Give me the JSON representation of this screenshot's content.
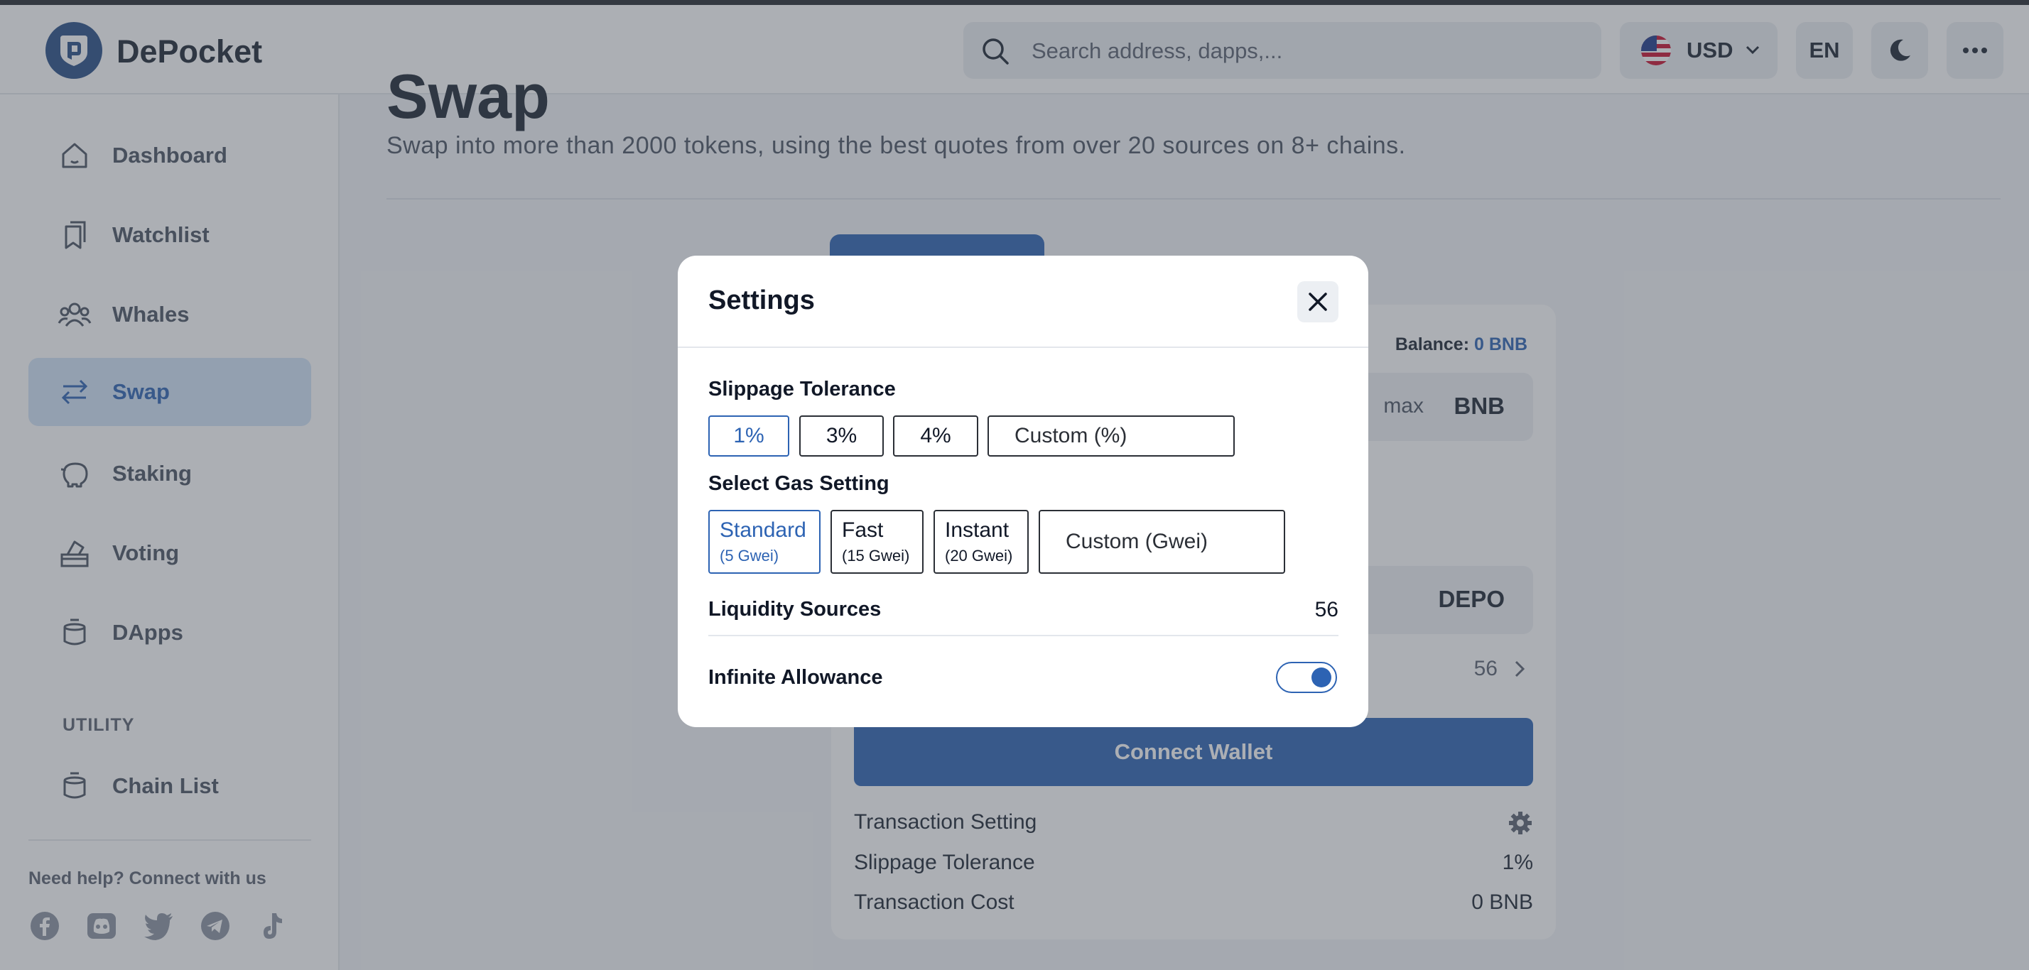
{
  "app": {
    "brand": "DePocket"
  },
  "header": {
    "search_placeholder": "Search address, dapps,...",
    "currency": "USD",
    "language": "EN"
  },
  "sidebar": {
    "items": [
      {
        "label": "Dashboard",
        "icon": "home-icon",
        "active": false
      },
      {
        "label": "Watchlist",
        "icon": "bookmark-icon",
        "active": false
      },
      {
        "label": "Whales",
        "icon": "users-icon",
        "active": false
      },
      {
        "label": "Swap",
        "icon": "swap-arrows-icon",
        "active": true
      },
      {
        "label": "Staking",
        "icon": "piggy-bank-icon",
        "active": false
      },
      {
        "label": "Voting",
        "icon": "ballot-box-icon",
        "active": false
      },
      {
        "label": "DApps",
        "icon": "stack-icon",
        "active": false
      }
    ],
    "utility_heading": "UTILITY",
    "utility_items": [
      {
        "label": "Chain List",
        "icon": "stack-icon"
      }
    ],
    "help_text": "Need help? Connect with us",
    "socials": [
      "facebook-icon",
      "discord-icon",
      "twitter-icon",
      "telegram-icon",
      "tiktok-icon"
    ]
  },
  "main": {
    "title": "Swap",
    "subtitle": "Swap into more than 2000 tokens, using the best quotes from over 20 sources on 8+ chains."
  },
  "swap_card": {
    "balance_label": "Balance:",
    "balance_value": "0 BNB",
    "max_label": "max",
    "from_token": "BNB",
    "to_token": "DEPO",
    "liquidity_count": "56",
    "connect_label": "Connect Wallet",
    "transaction_setting_label": "Transaction Setting",
    "slippage_label": "Slippage Tolerance",
    "slippage_value": "1%",
    "cost_label": "Transaction Cost",
    "cost_value": "0 BNB"
  },
  "modal": {
    "title": "Settings",
    "slippage_heading": "Slippage Tolerance",
    "slippage_options": [
      "1%",
      "3%",
      "4%"
    ],
    "slippage_selected": "1%",
    "slippage_custom_placeholder": "Custom (%)",
    "gas_heading": "Select Gas Setting",
    "gas_options": [
      {
        "label": "Standard",
        "sub": "(5 Gwei)"
      },
      {
        "label": "Fast",
        "sub": "(15 Gwei)"
      },
      {
        "label": "Instant",
        "sub": "(20 Gwei)"
      }
    ],
    "gas_selected": "Standard",
    "gas_custom_placeholder": "Custom (Gwei)",
    "liquidity_label": "Liquidity Sources",
    "liquidity_value": "56",
    "allowance_label": "Infinite Allowance",
    "allowance_on": true
  },
  "colors": {
    "accent": "#2d63b3",
    "active_bg": "#d2e3f7",
    "overlay": "#4a4f58"
  }
}
